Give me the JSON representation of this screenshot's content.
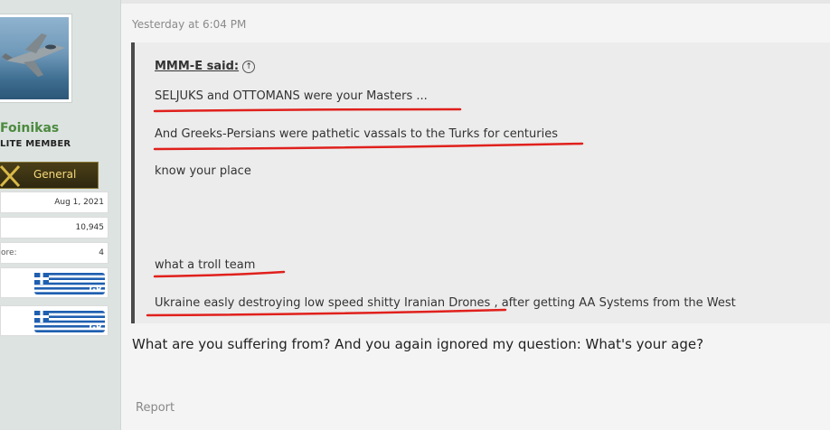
{
  "user": {
    "name": "Foinikas",
    "title": "LITE MEMBER",
    "rank": "General",
    "stats": [
      {
        "label": "",
        "value": "Aug 1, 2021"
      },
      {
        "label": "",
        "value": "10,945"
      },
      {
        "label": "ore:",
        "value": "4"
      }
    ],
    "flags": [
      {
        "text": ".GR"
      },
      {
        "text": ".GR"
      }
    ]
  },
  "post": {
    "date": "Yesterday at 6:04 PM",
    "quote": {
      "author_said": "MMM-E said:",
      "lines": [
        "SELJUKS and OTTOMANS were your Masters ...",
        "And Greeks-Persians were pathetic vassals to the Turks for centuries",
        "know your place",
        "what a troll team",
        "Ukraine easly destroying low speed shitty Iranian Drones , after getting AA Systems from the West"
      ]
    },
    "body": "What are you suffering from? And you again ignored my question: What's your age?",
    "report_label": "Report"
  },
  "colors": {
    "username": "#4c8a3e",
    "underline": "#e0201c",
    "quote_bar": "#4a4a4a",
    "quote_bg": "#ececec"
  }
}
